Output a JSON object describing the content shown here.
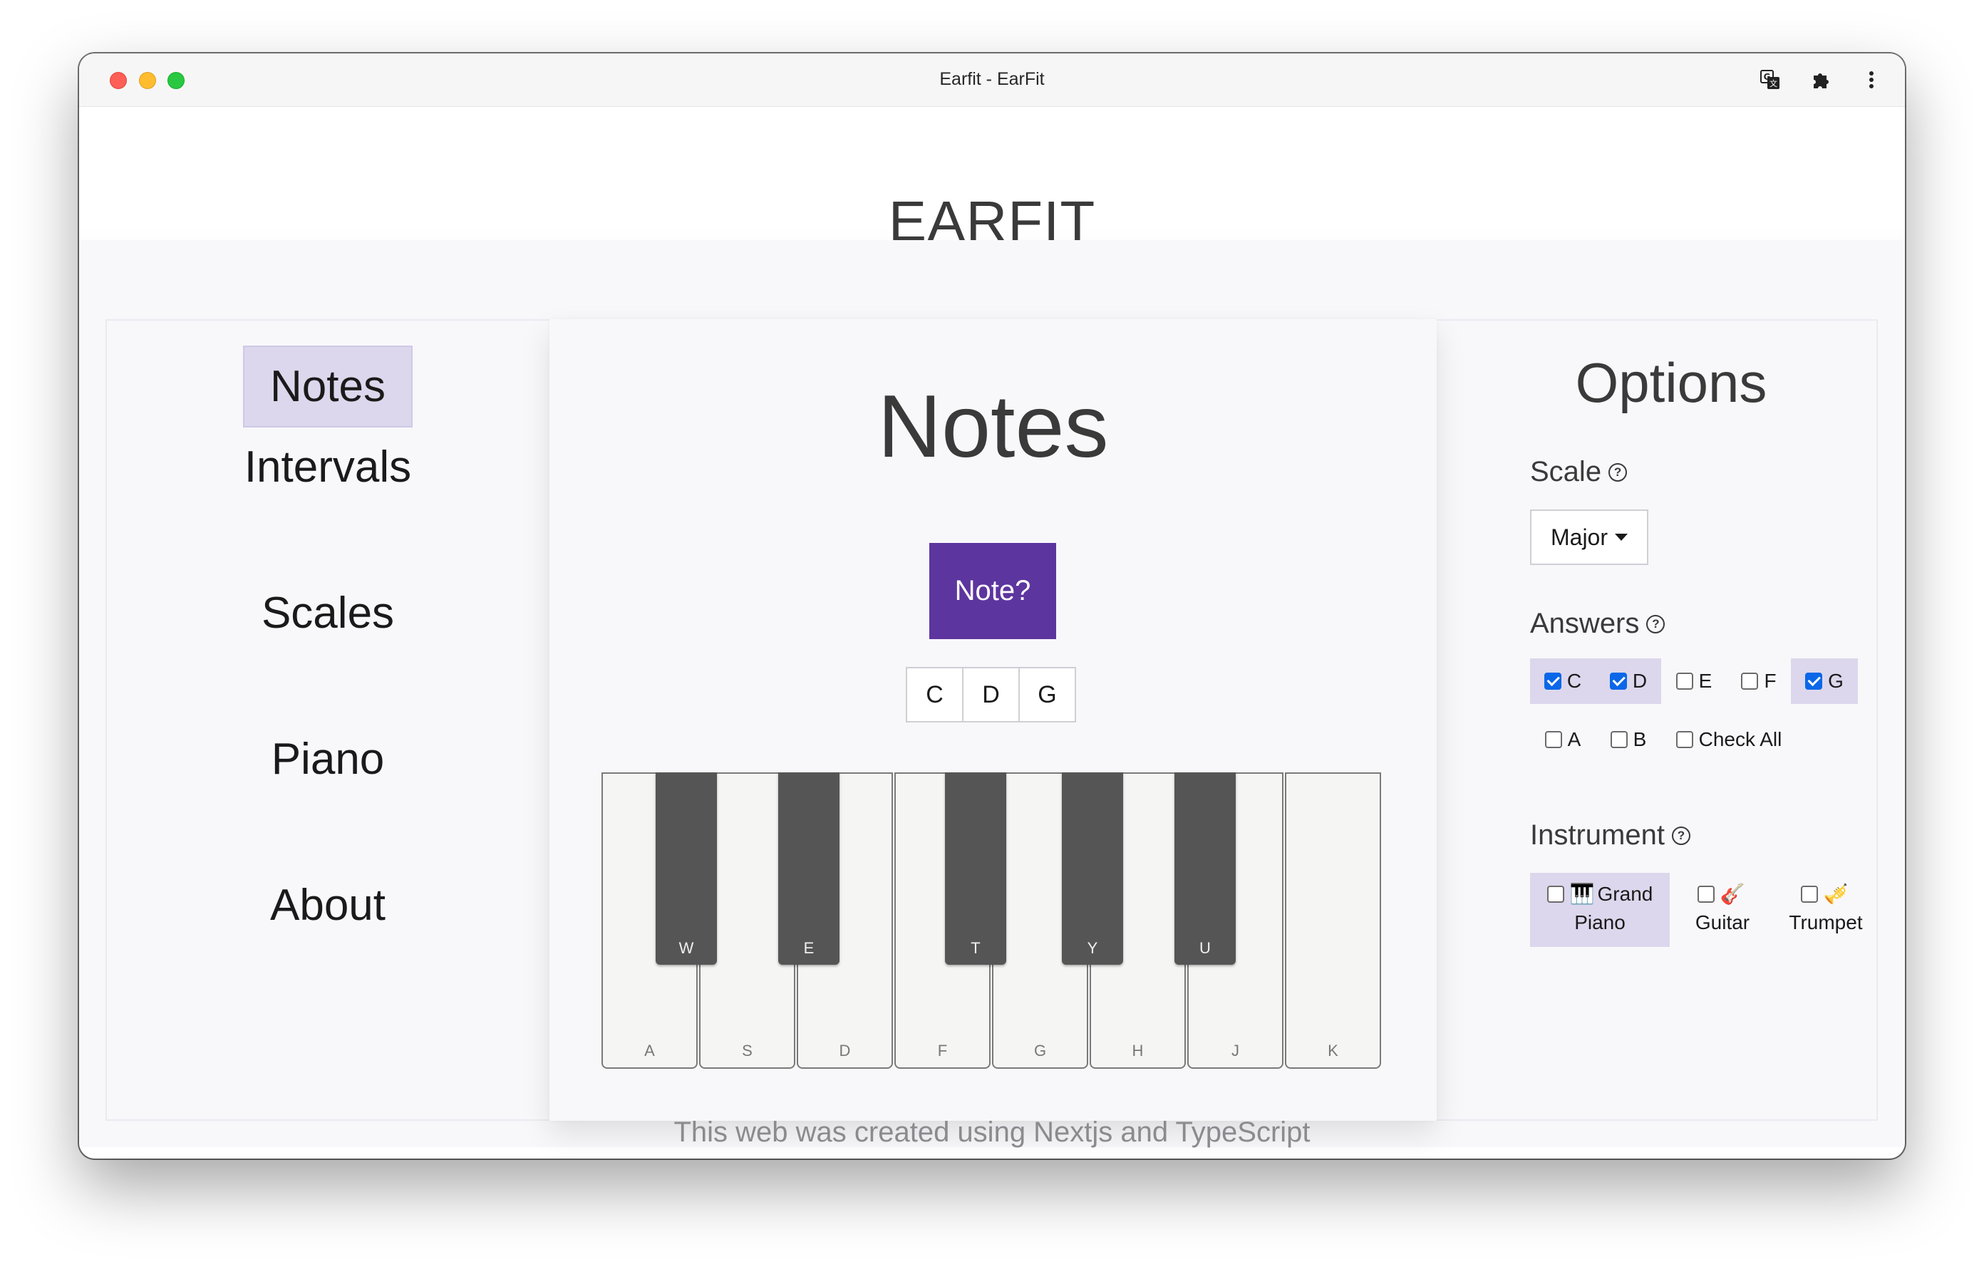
{
  "window": {
    "title": "Earfit - EarFit"
  },
  "app": {
    "title": "EARFIT"
  },
  "sidebar": {
    "items": [
      {
        "label": "Notes",
        "active": true
      },
      {
        "label": "Intervals",
        "active": false
      },
      {
        "label": "Scales",
        "active": false
      },
      {
        "label": "Piano",
        "active": false
      },
      {
        "label": "About",
        "active": false
      }
    ]
  },
  "main": {
    "title": "Notes",
    "note_button": "Note?",
    "answers": [
      "C",
      "D",
      "G"
    ],
    "piano": {
      "white_keys": [
        "A",
        "S",
        "D",
        "F",
        "G",
        "H",
        "J",
        "K"
      ],
      "black_keys": [
        "W",
        "E",
        "T",
        "Y",
        "U"
      ]
    }
  },
  "options": {
    "title": "Options",
    "scale": {
      "label": "Scale",
      "value": "Major"
    },
    "answers": {
      "label": "Answers",
      "items": [
        {
          "label": "C",
          "checked": true
        },
        {
          "label": "D",
          "checked": true
        },
        {
          "label": "E",
          "checked": false
        },
        {
          "label": "F",
          "checked": false
        },
        {
          "label": "G",
          "checked": true
        },
        {
          "label": "A",
          "checked": false
        },
        {
          "label": "B",
          "checked": false
        }
      ],
      "check_all": "Check All"
    },
    "instrument": {
      "label": "Instrument",
      "items": [
        {
          "icon": "piano-icon",
          "line1": "Grand",
          "line2": "Piano",
          "checked": true
        },
        {
          "icon": "guitar-icon",
          "line1": "",
          "line2": "Guitar",
          "checked": false
        },
        {
          "icon": "trumpet-icon",
          "line1": "",
          "line2": "Trumpet",
          "checked": false
        }
      ]
    }
  },
  "footer": {
    "text": "This web was created using Nextjs and TypeScript"
  },
  "colors": {
    "accent": "#5d359e",
    "active_bg": "#dcd7ec",
    "checkbox": "#0b67e8"
  }
}
